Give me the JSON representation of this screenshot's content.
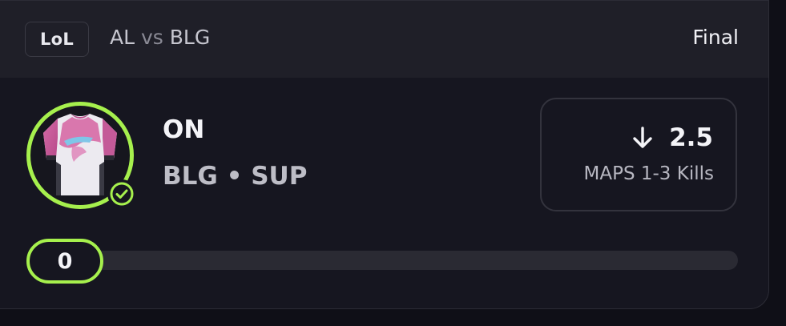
{
  "header": {
    "game_badge": "LoL",
    "team_a": "AL",
    "vs": "vs",
    "team_b": "BLG",
    "status": "Final"
  },
  "player": {
    "name": "ON",
    "team_position": "BLG • SUP",
    "avatar_icon": "jersey-icon",
    "status_icon": "check-circle-icon"
  },
  "pick": {
    "direction_icon": "arrow-down-icon",
    "line": "2.5",
    "stat": "MAPS 1-3 Kills"
  },
  "progress": {
    "value_label": "0",
    "fraction": 0
  },
  "colors": {
    "accent": "#a6f04d",
    "background": "#161620",
    "header": "#1f1f28"
  }
}
